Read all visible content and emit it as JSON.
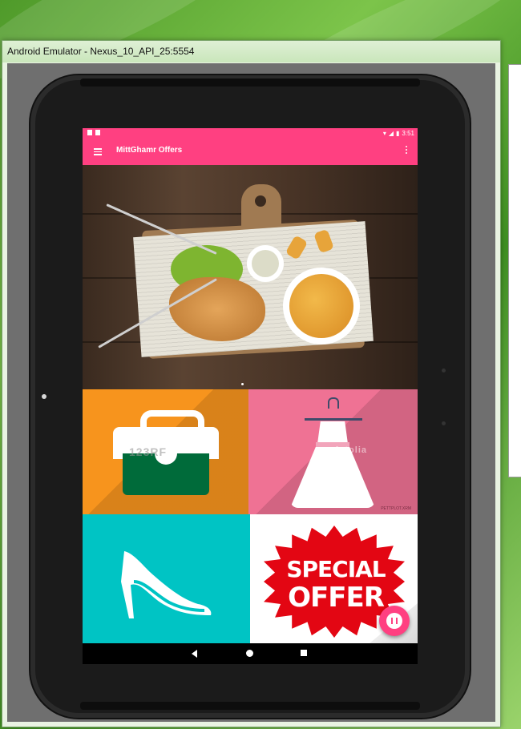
{
  "window": {
    "title": "Android Emulator - Nexus_10_API_25:5554"
  },
  "status_bar": {
    "time": "3:51",
    "icons": [
      "notification-icon",
      "notification-icon",
      "wifi-icon",
      "battery-icon"
    ]
  },
  "app_bar": {
    "title": "MittGhamr Offers",
    "menu_icon": "hamburger-menu-icon",
    "overflow_icon": "more-vert-icon"
  },
  "banner": {
    "description_icon": "food-banner-image"
  },
  "tiles": [
    {
      "name": "bags",
      "color": "#f7941d",
      "watermark": "123RF"
    },
    {
      "name": "dresses",
      "color": "#ef7294",
      "watermark": "fotolia",
      "credit": "PETTPLOT.XRM"
    },
    {
      "name": "shoes",
      "color": "#00c4c4"
    },
    {
      "name": "offers",
      "color": "#ffffff",
      "line1": "SPECIAL",
      "line2": "OFFER"
    }
  ],
  "fab": {
    "icon": "pause-icon",
    "color": "#ff4081"
  },
  "nav_bar": {
    "icons": [
      "back-icon",
      "home-icon",
      "recents-icon"
    ]
  },
  "colors": {
    "accent": "#ff4081"
  }
}
